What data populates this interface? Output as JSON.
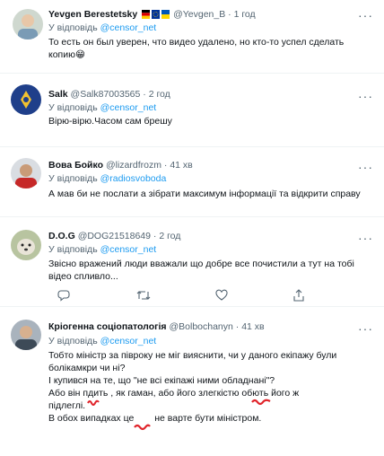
{
  "tweets": [
    {
      "name": "Yevgen Berestetsky",
      "handle": "@Yevgen_B",
      "time": "1 год",
      "reply_prefix": "",
      "reply_to": "",
      "lines": [
        "То есть он был уверен, что видео удалено,  но кто-то успел сделать",
        "копию"
      ],
      "emoji": "😁"
    },
    {
      "name": "Salk",
      "handle": "@Salk87003565",
      "time": "2 год",
      "reply_prefix": "У відповідь",
      "reply_to": "@censor_net",
      "lines": [
        "Вірю-вірю.Часом сам брешу"
      ]
    },
    {
      "name": "Вова Бойко",
      "handle": "@lizardfrozm",
      "time": "41 хв",
      "reply_prefix": "У відповідь",
      "reply_to": "@radiosvoboda",
      "lines": [
        "А мав би не послати а зібрати максимум інформації та  відкрити справу"
      ]
    },
    {
      "name": "D.O.G",
      "handle": "@DOG21518649",
      "time": "2 год",
      "reply_prefix": "У відповідь",
      "reply_to": "@censor_net",
      "lines": [
        "Звісно вражений люди вважали що добре все почистили а тут на тобі",
        "відео спливло..."
      ]
    },
    {
      "name": "Кріогенна соціопатологія",
      "handle": "@Bolbochanyn",
      "time": "41 хв",
      "reply_prefix": "У відповідь",
      "reply_to": "@censor_net",
      "lines": [
        "Тобто міністр за півроку не міг вияснити, чи у даного екіпажу були",
        "болікамкри чи ні?",
        "І купився на те, що \"не всі екіпажі ними обладнані\"?",
        "Або він п",
        "дить , як гаман, або його злегкістю об",
        "ють його ж",
        "підлеглі.",
        "В обох випадках це",
        " не варте бути міністром."
      ]
    }
  ],
  "first_reply_prefix": "У відповідь",
  "first_reply_to": "@censor_net",
  "more_glyph": "···",
  "colors": {
    "link": "#1d9bf0",
    "muted": "#536471",
    "text": "#0f1419",
    "scribble": "#e0242b"
  }
}
